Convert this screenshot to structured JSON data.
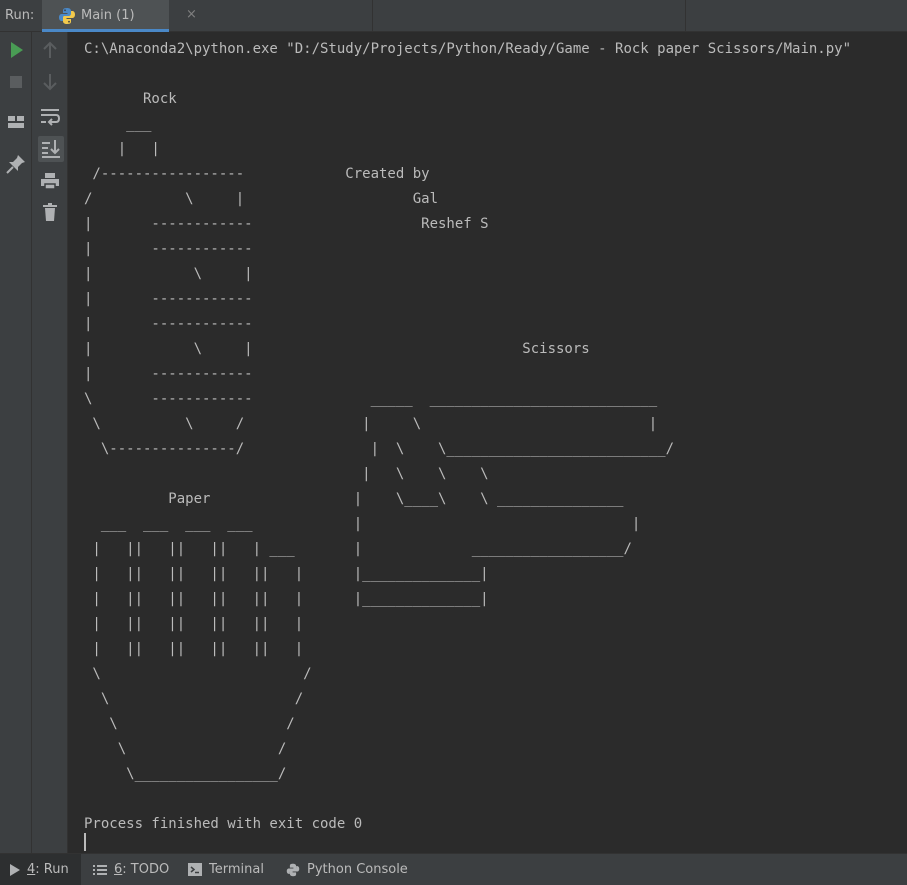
{
  "header": {
    "run_label": "Run:",
    "tab_title": "Main (1)",
    "tab_close": "×"
  },
  "toolbar_left": [
    {
      "icon": "run-icon",
      "color": "#499c54"
    },
    {
      "icon": "stop-icon"
    },
    {
      "icon": "layout-icon"
    },
    {
      "icon": "pin-icon"
    }
  ],
  "toolbar_right": [
    {
      "icon": "arrow-up-icon"
    },
    {
      "icon": "arrow-down-icon"
    },
    {
      "icon": "soft-wrap-icon"
    },
    {
      "icon": "scroll-to-end-icon"
    },
    {
      "icon": "print-icon"
    },
    {
      "icon": "trash-icon"
    }
  ],
  "console": {
    "command_line": "C:\\Anaconda2\\python.exe \"D:/Study/Projects/Python/Ready/Game - Rock paper Scissors/Main.py\"",
    "output": "\n       Rock\n     ___\n    |   |\n /-----------------            Created by\n/           \\     |                    Gal\n|       ------------                    Reshef S\n|       ------------\n|            \\     |\n|       ------------\n|       ------------\n|            \\     |                                Scissors\n|       ------------\n\\       ------------              _____  ___________________________\n \\          \\     /              |     \\                           |\n  \\---------------/               |  \\    \\__________________________/\n                                 |   \\    \\    \\\n          Paper                 |    \\____\\    \\ _______________\n  ___  ___  ___  ___            |                                |\n |   ||   ||   ||   | ___       |             __________________/\n |   ||   ||   ||   ||   |      |______________|\n |   ||   ||   ||   ||   |      |______________|\n |   ||   ||   ||   ||   |\n |   ||   ||   ||   ||   |\n \\                        /\n  \\                      /\n   \\                    /\n    \\                  /\n     \\_________________/\n",
    "process_status": "Process finished with exit code 0"
  },
  "bottom_bar": {
    "run": {
      "num": "4",
      "label": ": Run"
    },
    "todo": {
      "num": "6",
      "label": ": TODO"
    },
    "terminal": "Terminal",
    "python_console": "Python Console"
  },
  "colors": {
    "background": "#2b2b2b",
    "panel": "#3c3f41",
    "text": "#bbbbbb",
    "accent": "#4a88c7",
    "run_green": "#499c54"
  }
}
